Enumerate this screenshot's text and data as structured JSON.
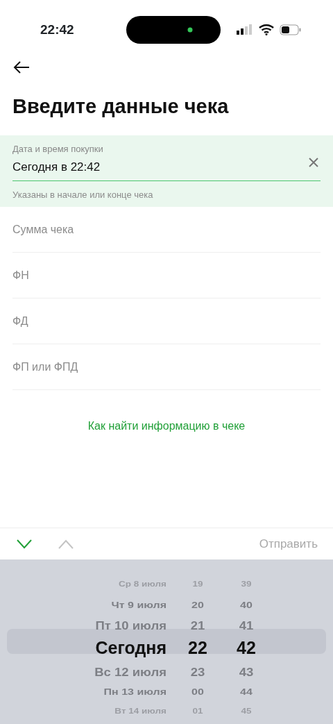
{
  "status_bar": {
    "time": "22:42"
  },
  "title": "Введите данные чека",
  "date_field": {
    "label": "Дата и время покупки",
    "value": "Сегодня в 22:42",
    "hint": "Указаны в начале или конце чека",
    "focused": true
  },
  "fields": [
    {
      "placeholder": "Сумма чека"
    },
    {
      "placeholder": "ФН"
    },
    {
      "placeholder": "ФД"
    },
    {
      "placeholder": "ФП или ФПД"
    }
  ],
  "help_link": "Как найти информацию в чеке",
  "toolbar": {
    "next_enabled": true,
    "previous_enabled": false,
    "submit": {
      "label": "Отправить",
      "disabled": true
    }
  },
  "picker": {
    "rows": [
      {
        "day": "Ср 8 июля",
        "hour": "19",
        "minute": "39",
        "selected": false
      },
      {
        "day": "Чт 9 июля",
        "hour": "20",
        "minute": "40",
        "selected": false
      },
      {
        "day": "Пт 10 июля",
        "hour": "21",
        "minute": "41",
        "selected": false
      },
      {
        "day": "Сегодня",
        "hour": "22",
        "minute": "42",
        "selected": true
      },
      {
        "day": "Вс 12 июля",
        "hour": "23",
        "minute": "43",
        "selected": false
      },
      {
        "day": "Пн 13 июля",
        "hour": "00",
        "minute": "44",
        "selected": false
      },
      {
        "day": "Вт 14 июля",
        "hour": "01",
        "minute": "45",
        "selected": false
      }
    ]
  }
}
